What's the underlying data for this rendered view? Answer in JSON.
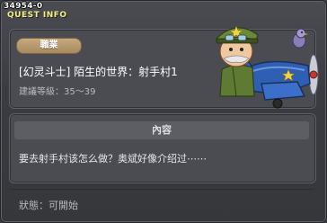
{
  "header": {
    "quest_id": "34954-0",
    "title": "QUEST INFO"
  },
  "job_tag": "職業",
  "quest_name": "[幻灵斗士] 陌生的世界：射手村1",
  "level_text": "建議等級：35～39",
  "content": {
    "header": "內容",
    "text": "要去射手村该怎么做？奥斌好像介绍过⋯⋯"
  },
  "status_text": "狀態：可開始",
  "colors": {
    "title_yellow": "#f0f080",
    "panel": "#4a4c51",
    "tag": "#b89968"
  }
}
